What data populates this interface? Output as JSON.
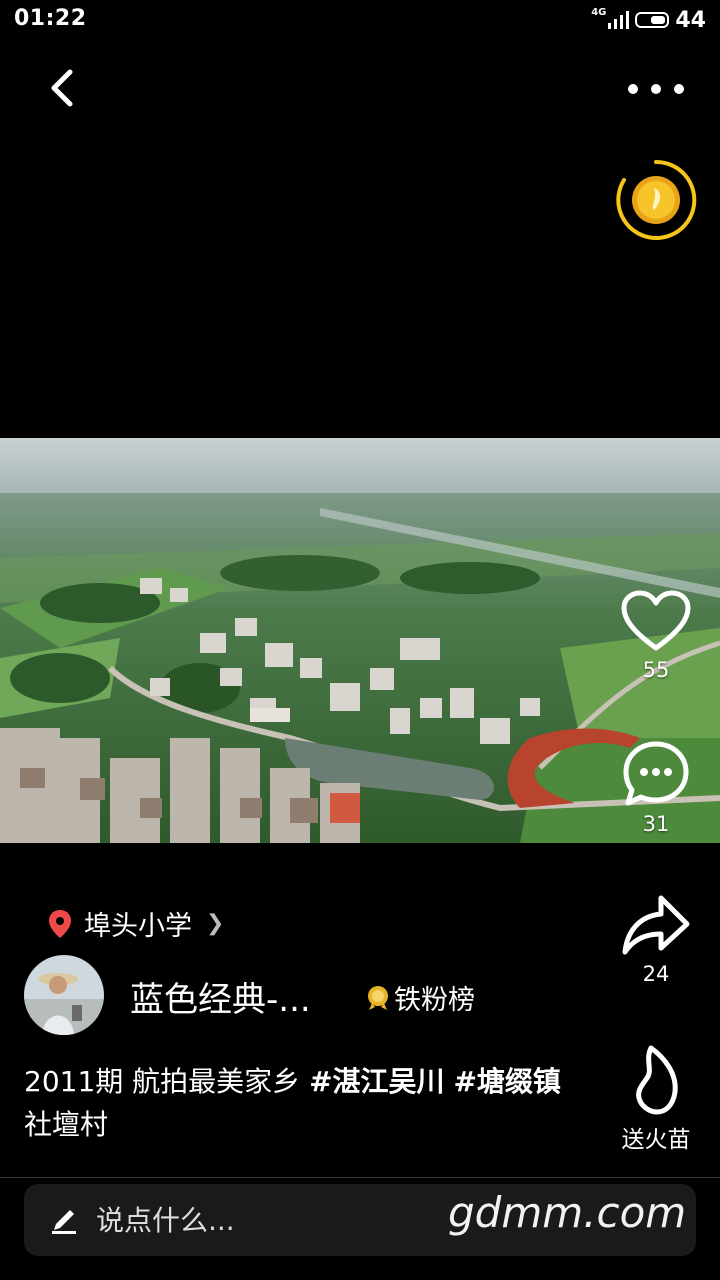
{
  "status_bar": {
    "time": "01:22",
    "network": "4G",
    "battery": "44"
  },
  "post": {
    "location": "埠头小学",
    "author": "蓝色经典-...",
    "badge": "铁粉榜",
    "caption_plain_1": "2011期 航拍最美家乡 ",
    "caption_tag_1": "#湛江吴川",
    "caption_space": " ",
    "caption_tag_2": "#塘缀镇",
    "caption_plain_2": " 社壇村"
  },
  "actions": {
    "likes": "55",
    "comments": "31",
    "shares": "24",
    "gift_label": "送火苗"
  },
  "comment_input": {
    "placeholder": "说点什么..."
  },
  "watermark": "gdmm.com",
  "colors": {
    "accent_yellow": "#f5c518",
    "location_pin": "#ef4a4a",
    "background": "#000000"
  }
}
